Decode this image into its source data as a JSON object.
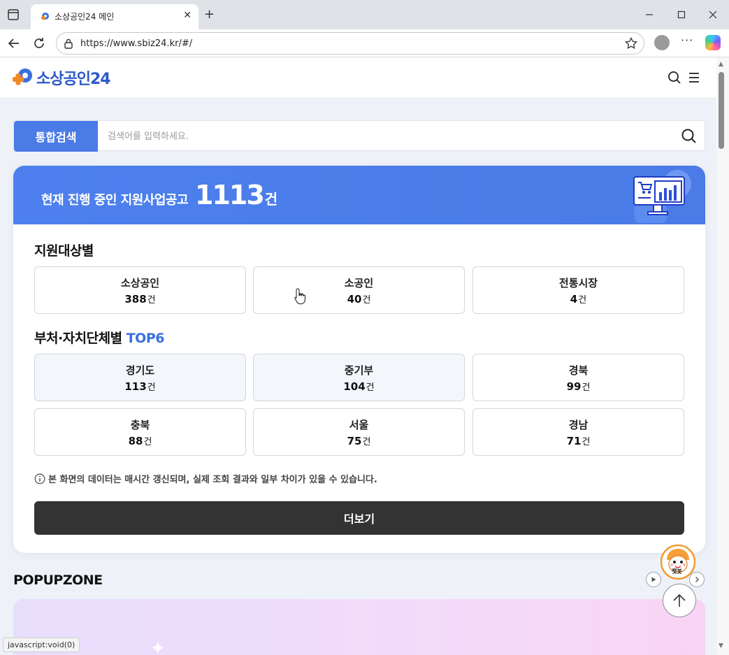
{
  "browser": {
    "tab_title": "소상공인24 메인",
    "url": "https://www.sbiz24.kr/#/",
    "new_tab_symbol": "+",
    "close_tab_symbol": "✕",
    "more_symbol": "···",
    "status_text": "javascript:void(0)"
  },
  "header": {
    "logo_text": "소상공인24",
    "brand_color": "#2e5ac7"
  },
  "search": {
    "tag_label": "통합검색",
    "placeholder": "검색어를 입력하세요."
  },
  "summary": {
    "label": "현재 진행 중인 지원사업공고",
    "count": "1113",
    "unit": "건",
    "banner_color": "#4a7be6"
  },
  "by_target": {
    "title": "지원대상별",
    "items": [
      {
        "name": "소상공인",
        "value": "388",
        "unit": "건"
      },
      {
        "name": "소공인",
        "value": "40",
        "unit": "건"
      },
      {
        "name": "전통시장",
        "value": "4",
        "unit": "건"
      }
    ]
  },
  "by_agency": {
    "title_main": "부처·자치단체별",
    "title_accent": "TOP6",
    "items": [
      {
        "name": "경기도",
        "value": "113",
        "unit": "건"
      },
      {
        "name": "중기부",
        "value": "104",
        "unit": "건"
      },
      {
        "name": "경북",
        "value": "99",
        "unit": "건"
      },
      {
        "name": "충북",
        "value": "88",
        "unit": "건"
      },
      {
        "name": "서울",
        "value": "75",
        "unit": "건"
      },
      {
        "name": "경남",
        "value": "71",
        "unit": "건"
      }
    ]
  },
  "notice": "본 화면의 데이터는 매시간 갱신되며, 실제 조회 결과와 일부 차이가 있을 수 있습니다.",
  "more_button": "더보기",
  "popupzone": {
    "title": "POPUPZONE"
  },
  "chatbot": {
    "label": "챗봇"
  }
}
